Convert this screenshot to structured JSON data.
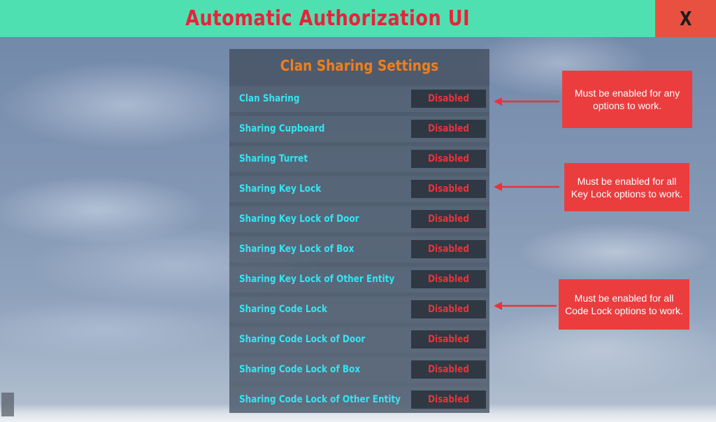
{
  "header": {
    "title": "Automatic Authorization UI",
    "close_label": "X"
  },
  "panel": {
    "title": "Clan Sharing Settings",
    "settings": [
      {
        "label": "Clan Sharing",
        "status": "Disabled"
      },
      {
        "label": "Sharing Cupboard",
        "status": "Disabled"
      },
      {
        "label": "Sharing Turret",
        "status": "Disabled"
      },
      {
        "label": "Sharing Key Lock",
        "status": "Disabled"
      },
      {
        "label": "Sharing Key Lock of Door",
        "status": "Disabled"
      },
      {
        "label": "Sharing Key Lock of Box",
        "status": "Disabled"
      },
      {
        "label": "Sharing Key Lock of Other Entity",
        "status": "Disabled"
      },
      {
        "label": "Sharing Code Lock",
        "status": "Disabled"
      },
      {
        "label": "Sharing Code Lock of Door",
        "status": "Disabled"
      },
      {
        "label": "Sharing Code Lock of Box",
        "status": "Disabled"
      },
      {
        "label": "Sharing Code Lock of Other Entity",
        "status": "Disabled"
      }
    ]
  },
  "callouts": [
    {
      "text": "Must be enabled for any options to work."
    },
    {
      "text": "Must be enabled for all Key Lock options to work."
    },
    {
      "text": "Must be enabled for all Code Lock options to work."
    }
  ],
  "colors": {
    "header_bg": "#4fe0b1",
    "title_text": "#e8233a",
    "close_bg": "#e8503f",
    "panel_title": "#f07f1a",
    "setting_label": "#33e6f2",
    "status_disabled": "#e8333c",
    "callout_bg": "#ec3d3e",
    "arrow": "#e8333c"
  }
}
